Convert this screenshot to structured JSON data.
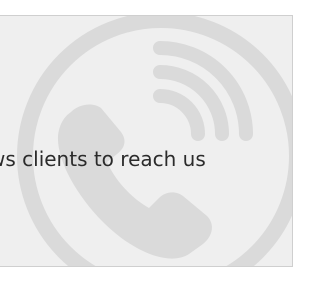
{
  "card": {
    "text": "ws clients to reach us",
    "watermark_icon": "phone-ringing-icon",
    "colors": {
      "background": "#efefef",
      "border": "#cfcfcf",
      "text": "#2b2b2b",
      "watermark": "#dadada"
    }
  }
}
